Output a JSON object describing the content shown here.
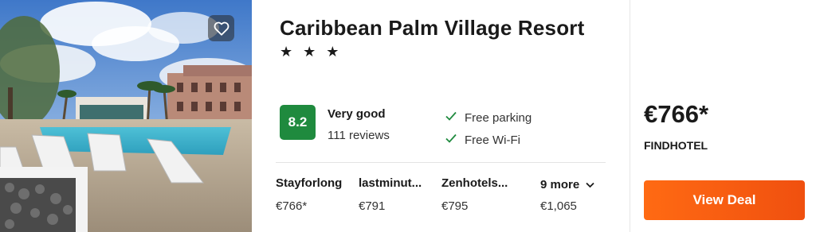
{
  "hotel": {
    "name": "Caribbean Palm Village Resort",
    "stars": "★ ★ ★",
    "rating": {
      "score": "8.2",
      "label": "Very good",
      "reviews": "111 reviews"
    },
    "amenities": [
      "Free parking",
      "Free Wi-Fi"
    ]
  },
  "providers": [
    {
      "name": "Stayforlong",
      "price": "€766*"
    },
    {
      "name": "lastminut...",
      "price": "€791"
    },
    {
      "name": "Zenhotels...",
      "price": "€795"
    }
  ],
  "more": {
    "label": "9 more",
    "price": "€1,065"
  },
  "deal": {
    "price": "€766*",
    "provider": "FINDHOTEL",
    "button": "View Deal"
  },
  "colors": {
    "rating_badge": "#1f8a3e",
    "deal_button": "#f25a10",
    "check": "#1f8a3e"
  },
  "icons": {
    "favorite": "heart-icon",
    "amenity": "check-icon",
    "more": "chevron-down-icon"
  }
}
